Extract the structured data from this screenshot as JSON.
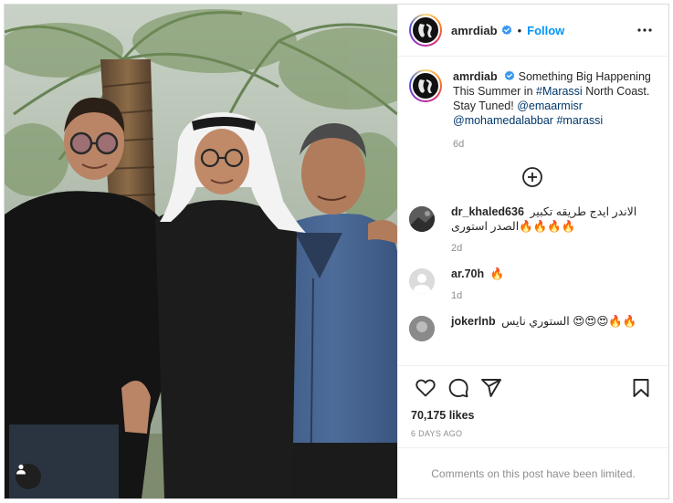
{
  "post": {
    "username": "amrdiab",
    "follow_label": "Follow",
    "dot": "•",
    "caption": {
      "username": "amrdiab",
      "text_1": "Something Big Happening This Summer in ",
      "hashtag_1": "#Marassi",
      "text_2": " North Coast. Stay Tuned! ",
      "mention_1": "@emaarmisr",
      "mention_2": "@mohamedalabbar",
      "hashtag_2": "#marassi",
      "age": "6d"
    },
    "comments": [
      {
        "username": "dr_khaled636",
        "text": "الاندر ايدج طريقه تكبير الصدر استورى🔥🔥🔥🔥",
        "age": "2d"
      },
      {
        "username": "ar.70h",
        "text": "🔥",
        "age": "1d"
      },
      {
        "username": "jokerlnb",
        "text": "الستوري نايس 😍😍😍🔥🔥",
        "age": ""
      }
    ],
    "likes": "70,175 likes",
    "time_ago": "6 DAYS AGO",
    "comments_limited": "Comments on this post have been limited."
  },
  "icons": {
    "verified": "verified-badge-icon",
    "more": "more-options-icon",
    "load_more": "plus-circle-icon",
    "like": "heart-icon",
    "comment": "comment-icon",
    "share": "share-icon",
    "save": "bookmark-icon",
    "tagged": "user-tag-icon"
  },
  "colors": {
    "accent": "#0095f6",
    "verified": "#3897f0",
    "muted": "#8e8e8e",
    "text": "#262626"
  }
}
